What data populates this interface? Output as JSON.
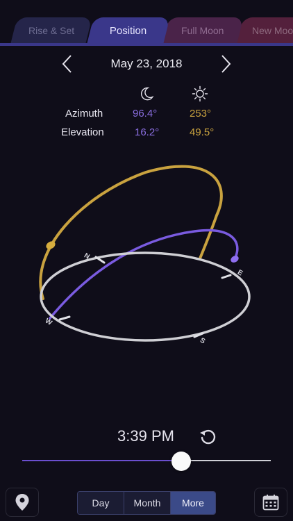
{
  "tabs": [
    {
      "label": "Rise & Set",
      "active": false
    },
    {
      "label": "Position",
      "active": true
    },
    {
      "label": "Full Moon",
      "active": false
    },
    {
      "label": "New Moo",
      "active": false
    }
  ],
  "date": "May 23, 2018",
  "table": {
    "columns": [
      "moon-icon",
      "sun-icon"
    ],
    "rows": [
      {
        "label": "Azimuth",
        "moon": "96.4°",
        "sun": "253°"
      },
      {
        "label": "Elevation",
        "moon": "16.2°",
        "sun": "49.5°"
      }
    ]
  },
  "compass": {
    "labels": [
      "N",
      "E",
      "S",
      "W"
    ]
  },
  "time": "3:39 PM",
  "slider": {
    "position": 0.64
  },
  "segments": [
    {
      "label": "Day",
      "active": false
    },
    {
      "label": "Month",
      "active": false
    },
    {
      "label": "More",
      "active": true
    }
  ],
  "colors": {
    "moon": "#7a5be0",
    "sun": "#c9a23f",
    "accent": "#3b4a88",
    "background": "#0f0d19"
  },
  "icons": {
    "location": "location-pin-icon",
    "calendar": "calendar-icon",
    "reset": "reset-icon"
  }
}
